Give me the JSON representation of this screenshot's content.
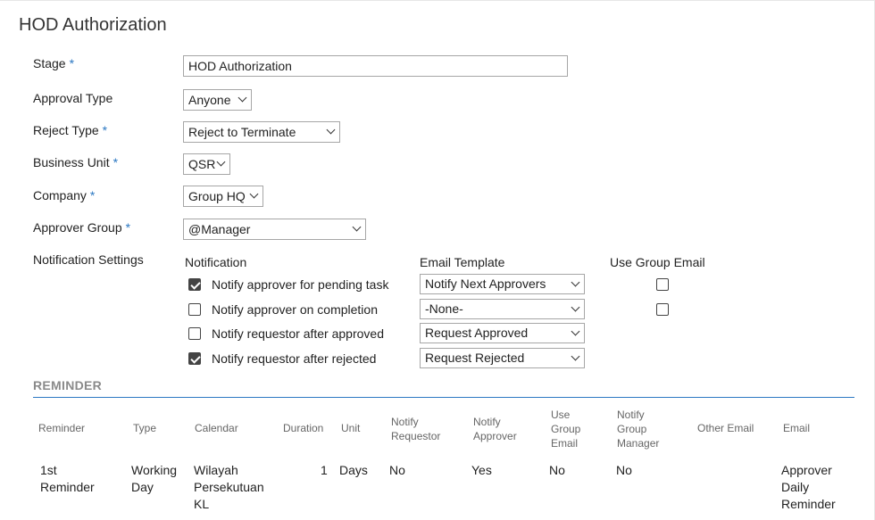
{
  "form": {
    "title": "HOD Authorization",
    "required_marker": "*",
    "stage": {
      "label": "Stage",
      "value": "HOD Authorization"
    },
    "approval_type": {
      "label": "Approval Type",
      "value": "Anyone"
    },
    "reject_type": {
      "label": "Reject Type",
      "value": "Reject to Terminate"
    },
    "business_unit": {
      "label": "Business Unit",
      "value": "QSR"
    },
    "company": {
      "label": "Company",
      "value": "Group HQ"
    },
    "approver_group": {
      "label": "Approver Group",
      "value": "@Manager"
    }
  },
  "notification": {
    "label": "Notification Settings",
    "col_notification": "Notification",
    "col_email_template": "Email Template",
    "col_use_group_email": "Use Group Email",
    "rows": [
      {
        "label": "Notify approver for pending task",
        "checked": true,
        "template": "Notify Next Approvers",
        "use_group_email": false
      },
      {
        "label": "Notify approver on completion",
        "checked": false,
        "template": "-None-",
        "use_group_email": false
      },
      {
        "label": "Notify requestor after approved",
        "checked": false,
        "template": "Request Approved"
      },
      {
        "label": "Notify requestor after rejected",
        "checked": true,
        "template": "Request Rejected"
      }
    ]
  },
  "reminder": {
    "section_title": "REMINDER",
    "headers": {
      "reminder": "Reminder",
      "type": "Type",
      "calendar": "Calendar",
      "duration": "Duration",
      "unit": "Unit",
      "notify_requestor": [
        "Notify",
        "Requestor"
      ],
      "notify_approver": [
        "Notify",
        "Approver"
      ],
      "use_group_email": [
        "Use",
        "Group",
        "Email"
      ],
      "notify_group_manager": [
        "Notify",
        "Group",
        "Manager"
      ],
      "other_email": "Other Email",
      "email": "Email"
    },
    "rows": [
      {
        "reminder": [
          "1st",
          "Reminder"
        ],
        "type": [
          "Working",
          "Day"
        ],
        "calendar": [
          "Wilayah",
          "Persekutuan",
          "KL"
        ],
        "duration": "1",
        "unit": "Days",
        "notify_requestor": "No",
        "notify_approver": "Yes",
        "use_group_email": "No",
        "notify_group_manager": "No",
        "other_email": "",
        "email": [
          "Approver",
          "Daily",
          "Reminder"
        ]
      }
    ]
  },
  "colors": {
    "accent": "#2b78c2",
    "section_text": "#8a8a8a",
    "header_text": "#666666"
  }
}
